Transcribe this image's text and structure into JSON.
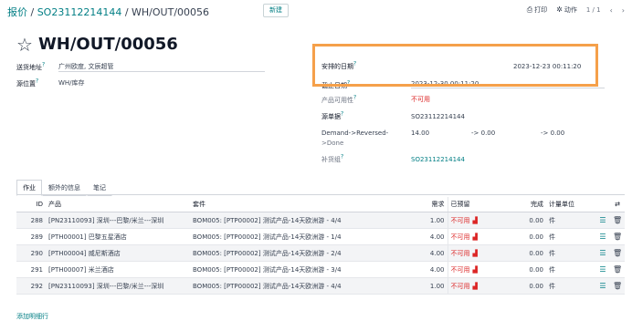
{
  "breadcrumb": {
    "parent1": "报价",
    "parent2": "SO23112214144",
    "current": "WH/OUT/00056"
  },
  "new_button": "新建",
  "actions": {
    "print": "打印",
    "action": "动作",
    "pager": "1 / 1"
  },
  "record": {
    "title": "WH/OUT/00056"
  },
  "left_fields": {
    "delivery_address_label": "送货地址",
    "delivery_address_value": "广州欧度, 文辰超管",
    "source_location_label": "源位置",
    "source_location_value": "WH/库存"
  },
  "right_fields": {
    "scheduled_date_label": "安排的日期",
    "scheduled_date_value": "2023-12-23 00:11:20",
    "deadline_label": "截止日期",
    "deadline_value": "2023-12-30 00:11:20",
    "availability_label": "产品可用性",
    "availability_value": "不可用",
    "source_doc_label": "源单据",
    "source_doc_value": "SO23112214144",
    "demand_label_1": "Demand->Reversed-",
    "demand_label_2": ">Done",
    "demand_v1": "14.00",
    "demand_v2": "-> 0.00",
    "demand_v3": "-> 0.00",
    "procurement_label": "补货组",
    "procurement_value": "SO23112214144"
  },
  "tabs": [
    "作业",
    "额外的信息",
    "笔记"
  ],
  "table": {
    "headers": [
      "ID",
      "产品",
      "套件",
      "需求",
      "已预留",
      "完成",
      "计量单位"
    ],
    "rows": [
      {
        "id": "288",
        "product": "[PN23110093] 深圳---巴黎/米兰---深圳",
        "kit": "BOM005: [PTP00002] 测试产品-14天欧洲游 - 4/4",
        "demand": "1.00",
        "reserved": "不可用",
        "done": "0.00",
        "uom": "件"
      },
      {
        "id": "289",
        "product": "[PTH00001] 巴黎五星酒店",
        "kit": "BOM005: [PTP00002] 测试产品-14天欧洲游 - 1/4",
        "demand": "4.00",
        "reserved": "不可用",
        "done": "0.00",
        "uom": "件"
      },
      {
        "id": "290",
        "product": "[PTH00004] 威尼斯酒店",
        "kit": "BOM005: [PTP00002] 测试产品-14天欧洲游 - 2/4",
        "demand": "4.00",
        "reserved": "不可用",
        "done": "0.00",
        "uom": "件"
      },
      {
        "id": "291",
        "product": "[PTH00007] 米兰酒店",
        "kit": "BOM005: [PTP00002] 测试产品-14天欧洲游 - 3/4",
        "demand": "4.00",
        "reserved": "不可用",
        "done": "0.00",
        "uom": "件"
      },
      {
        "id": "292",
        "product": "[PN23110093] 深圳---巴黎/米兰---深圳",
        "kit": "BOM005: [PTP00002] 测试产品-14天欧洲游 - 4/4",
        "demand": "1.00",
        "reserved": "不可用",
        "done": "0.00",
        "uom": "件"
      }
    ]
  },
  "add_line": "添加明细行",
  "colors": {
    "accent": "#017e84",
    "highlight": "#f5a04a",
    "danger": "#dc2626"
  }
}
